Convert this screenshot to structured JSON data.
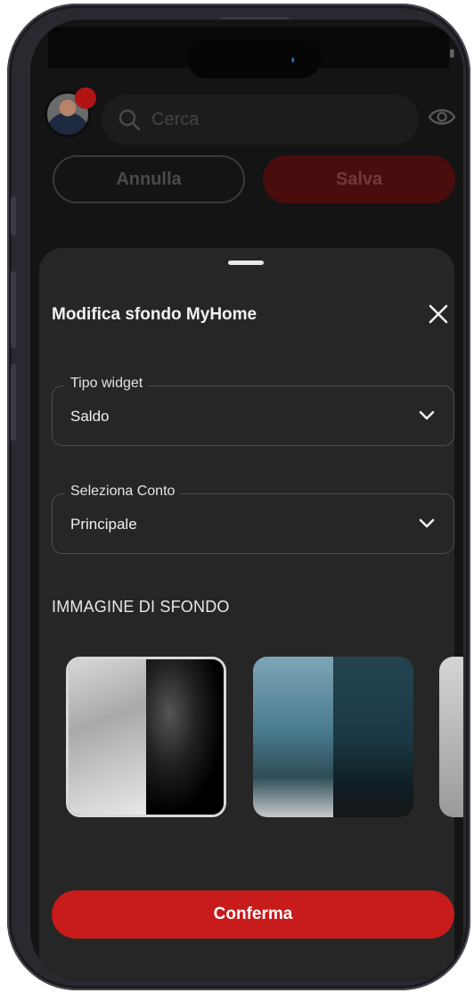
{
  "header": {
    "search_placeholder": "Cerca",
    "cancel_label": "Annulla",
    "save_label": "Salva"
  },
  "sheet": {
    "title": "Modifica sfondo MyHome",
    "widget_field": {
      "label": "Tipo widget",
      "value": "Saldo"
    },
    "account_field": {
      "label": "Seleziona Conto",
      "value": "Principale"
    },
    "background_section_title": "IMMAGINE DI SFONDO",
    "confirm_label": "Conferma"
  },
  "icons": {
    "search": "search-icon",
    "visibility": "eye-icon",
    "close": "close-icon",
    "dropdown": "chevron-down-icon"
  },
  "colors": {
    "accent": "#c81b1b",
    "sheet_background": "#262626",
    "badge": "#b01414"
  }
}
